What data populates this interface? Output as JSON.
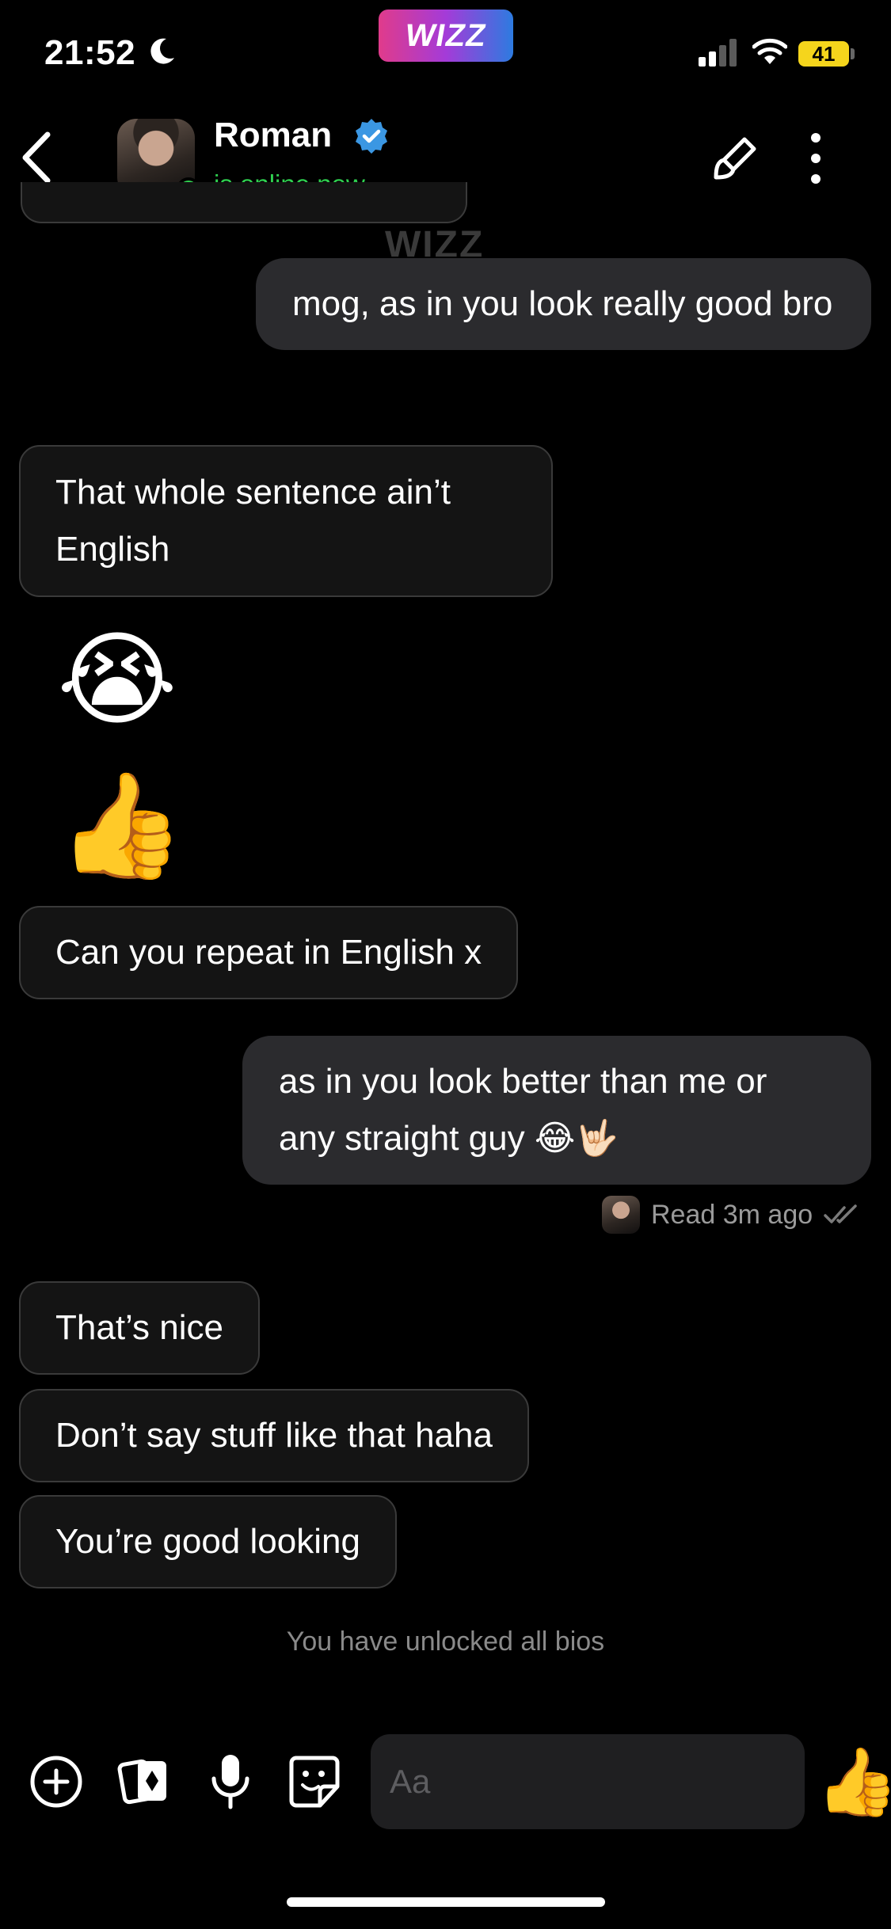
{
  "status_bar": {
    "time": "21:52",
    "battery": "41",
    "moon_icon": "moon-icon",
    "signal_icon": "cellular-signal-icon",
    "wifi_icon": "wifi-icon"
  },
  "app_logo": "WIZZ",
  "header": {
    "name": "Roman",
    "status": "is online now",
    "online_color": "#2fd150",
    "verified_color": "#3b97e3"
  },
  "watermark": "WIZZ",
  "messages": [
    {
      "direction": "outgoing",
      "text": "mog, as in you look really good bro"
    },
    {
      "direction": "incoming",
      "text": "That whole sentence ain’t English"
    },
    {
      "direction": "incoming",
      "emoji": "😭"
    },
    {
      "direction": "incoming",
      "emoji": "👍"
    },
    {
      "direction": "incoming",
      "text": "Can you repeat in English x"
    },
    {
      "direction": "outgoing",
      "text_line1": "as in you look better than me or",
      "text_line2": "any straight guy",
      "emoji": "😂🤟🏻"
    },
    {
      "direction": "incoming",
      "text": "That’s nice"
    },
    {
      "direction": "incoming",
      "text": "Don’t say stuff like that haha"
    },
    {
      "direction": "incoming",
      "text": "You’re good looking"
    }
  ],
  "read_receipt": "Read 3m ago",
  "notice": "You have unlocked all bios",
  "composer": {
    "placeholder": "Aa",
    "send_emoji": "👍"
  }
}
